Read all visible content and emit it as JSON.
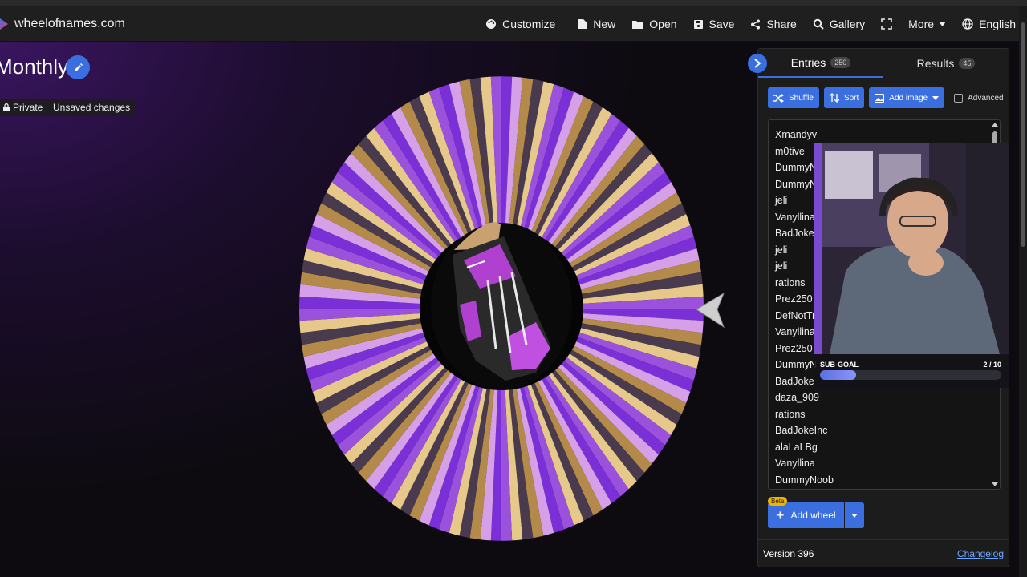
{
  "app": {
    "site_name": "wheelofnames.com"
  },
  "nav": {
    "customize": "Customize",
    "new": "New",
    "open": "Open",
    "save": "Save",
    "share": "Share",
    "gallery": "Gallery",
    "more": "More",
    "language": "English"
  },
  "wheel": {
    "title": "Monthly",
    "privacy": "Private",
    "status": "Unsaved changes",
    "colors": [
      "#7b2fd6",
      "#d6a0e8",
      "#b38a4a",
      "#4a3a4e",
      "#e6c98a",
      "#9a52dd"
    ],
    "center_image": "purple-glove-image"
  },
  "panel": {
    "tabs": [
      {
        "label": "Entries",
        "count": "250"
      },
      {
        "label": "Results",
        "count": "45"
      }
    ],
    "toolbar": {
      "shuffle": "Shuffle",
      "sort": "Sort",
      "add_image": "Add image",
      "advanced": "Advanced"
    },
    "entries": [
      "Xmandyv",
      "m0tive",
      "DummyN",
      "DummyN",
      "jeli",
      "Vanyllina",
      "BadJoke",
      "jeli",
      "jeli",
      "rations",
      "Prez250",
      "DefNotTri",
      "Vanyllina",
      "Prez250",
      "DummyN",
      "BadJoke",
      "daza_909",
      "rations",
      "BadJokeInc",
      "alaLaLBg",
      "Vanyllina",
      "DummyNoob"
    ],
    "add_wheel": {
      "beta": "Beta",
      "label": "Add wheel"
    },
    "footer": {
      "version": "Version 396",
      "changelog": "Changelog"
    }
  },
  "overlay": {
    "subgoal_label": "SUB-GOAL",
    "subgoal_count": "2 / 10",
    "subgoal_progress": 0.2
  },
  "colors": {
    "accent": "#3b6fe0",
    "panel_bg": "#1c1c1c",
    "topbar_bg": "#1f1f1f"
  }
}
